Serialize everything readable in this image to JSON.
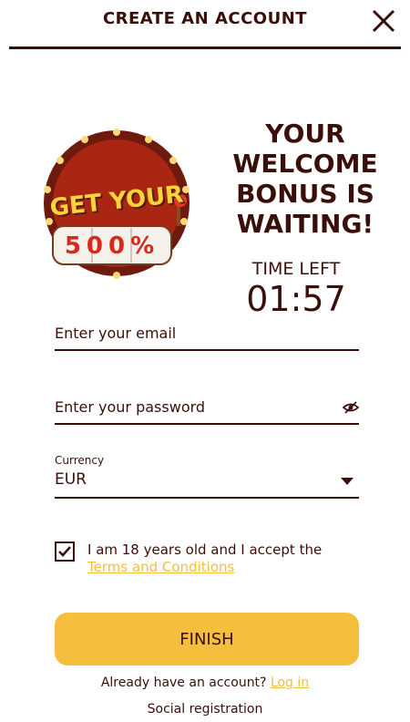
{
  "header": {
    "title": "CREATE AN ACCOUNT"
  },
  "promo": {
    "badge_top": "GET YOUR",
    "badge_amount": "500%",
    "headline_lines": [
      "YOUR",
      "WELCOME",
      "BONUS IS",
      "WAITING!"
    ],
    "timer_label": "TIME LEFT",
    "timer_value": "01:57"
  },
  "form": {
    "email_placeholder": "Enter your email",
    "password_placeholder": "Enter your password",
    "currency_label": "Currency",
    "currency_value": "EUR",
    "terms_text": "I am 18 years old and I accept the",
    "terms_link": "Terms and Conditions",
    "terms_checked": true,
    "finish_label": "FINISH",
    "login_prompt": "Already have an account?",
    "login_link": "Log in",
    "social_label": "Social registration"
  },
  "colors": {
    "primary": "#3a0f0a",
    "accent": "#f6be3d"
  }
}
